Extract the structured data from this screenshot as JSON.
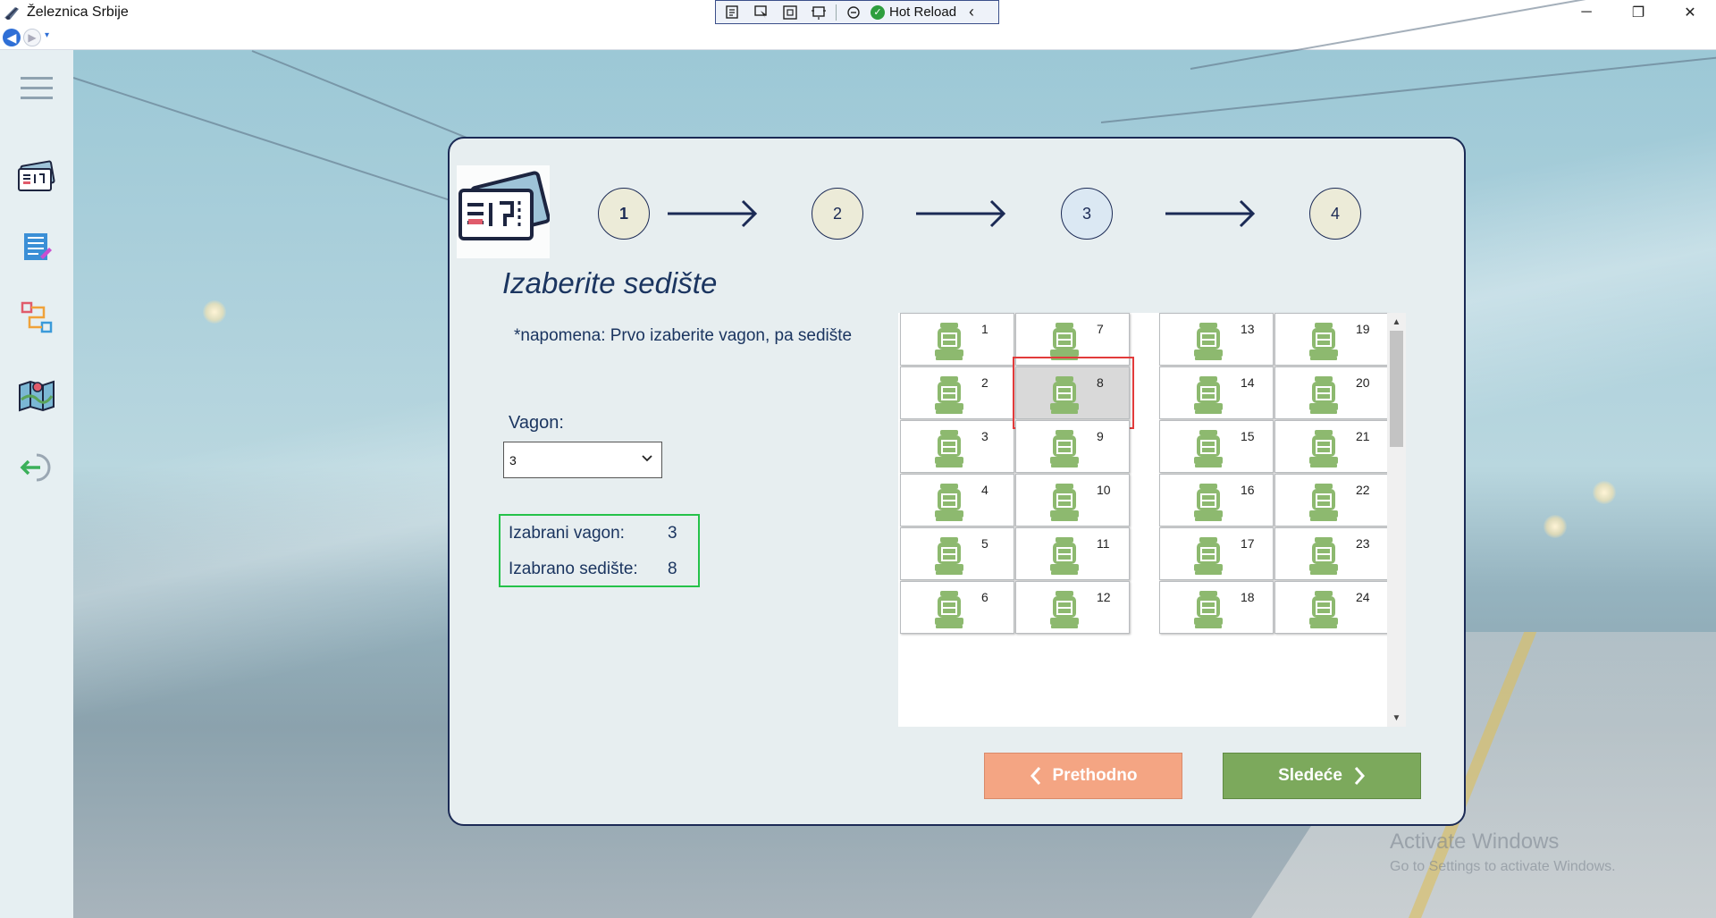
{
  "window": {
    "title": "Železnica Srbije",
    "minimize_glyph": "─",
    "maximize_glyph": "❐",
    "close_glyph": "✕"
  },
  "hot_reload": {
    "label": "Hot Reload",
    "collapse_glyph": "‹"
  },
  "navigation": {
    "back_glyph": "◀",
    "forward_glyph": "▶",
    "dropdown_glyph": "▾"
  },
  "sidebar": {
    "items": [
      {
        "name": "menu",
        "icon": "hamburger-icon"
      },
      {
        "name": "tickets",
        "icon": "ticket-icon"
      },
      {
        "name": "timetable",
        "icon": "list-document-icon"
      },
      {
        "name": "routes",
        "icon": "route-icon"
      },
      {
        "name": "map",
        "icon": "map-icon"
      },
      {
        "name": "logout",
        "icon": "logout-icon"
      }
    ]
  },
  "steps": [
    {
      "label": "1"
    },
    {
      "label": "2"
    },
    {
      "label": "3"
    },
    {
      "label": "4"
    }
  ],
  "page": {
    "heading": "Izaberite sedište",
    "note": "*napomena: Prvo izaberite vagon, pa sedište",
    "vagon_label": "Vagon:",
    "vagon_value": "3"
  },
  "summary": {
    "wagon_label": "Izabrani vagon:",
    "wagon_value": "3",
    "seat_label": "Izabrano sedište:",
    "seat_value": "8"
  },
  "seats": {
    "columns": [
      [
        "1",
        "2",
        "3",
        "4",
        "5",
        "6"
      ],
      [
        "7",
        "8",
        "9",
        "10",
        "11",
        "12"
      ],
      [
        "13",
        "14",
        "15",
        "16",
        "17",
        "18"
      ],
      [
        "19",
        "20",
        "21",
        "22",
        "23",
        "24"
      ]
    ],
    "selected": "8",
    "seat_color": "#8db96f"
  },
  "buttons": {
    "prev": "Prethodno",
    "next": "Sledeće"
  },
  "watermark": {
    "line1": "Activate Windows",
    "line2": "Go to Settings to activate Windows."
  },
  "colors": {
    "prev_button": "#f4a583",
    "next_button": "#7ca95c",
    "summary_border": "#25c24a",
    "selection_border": "#e23b3b",
    "accent_navy": "#1b2a55"
  }
}
